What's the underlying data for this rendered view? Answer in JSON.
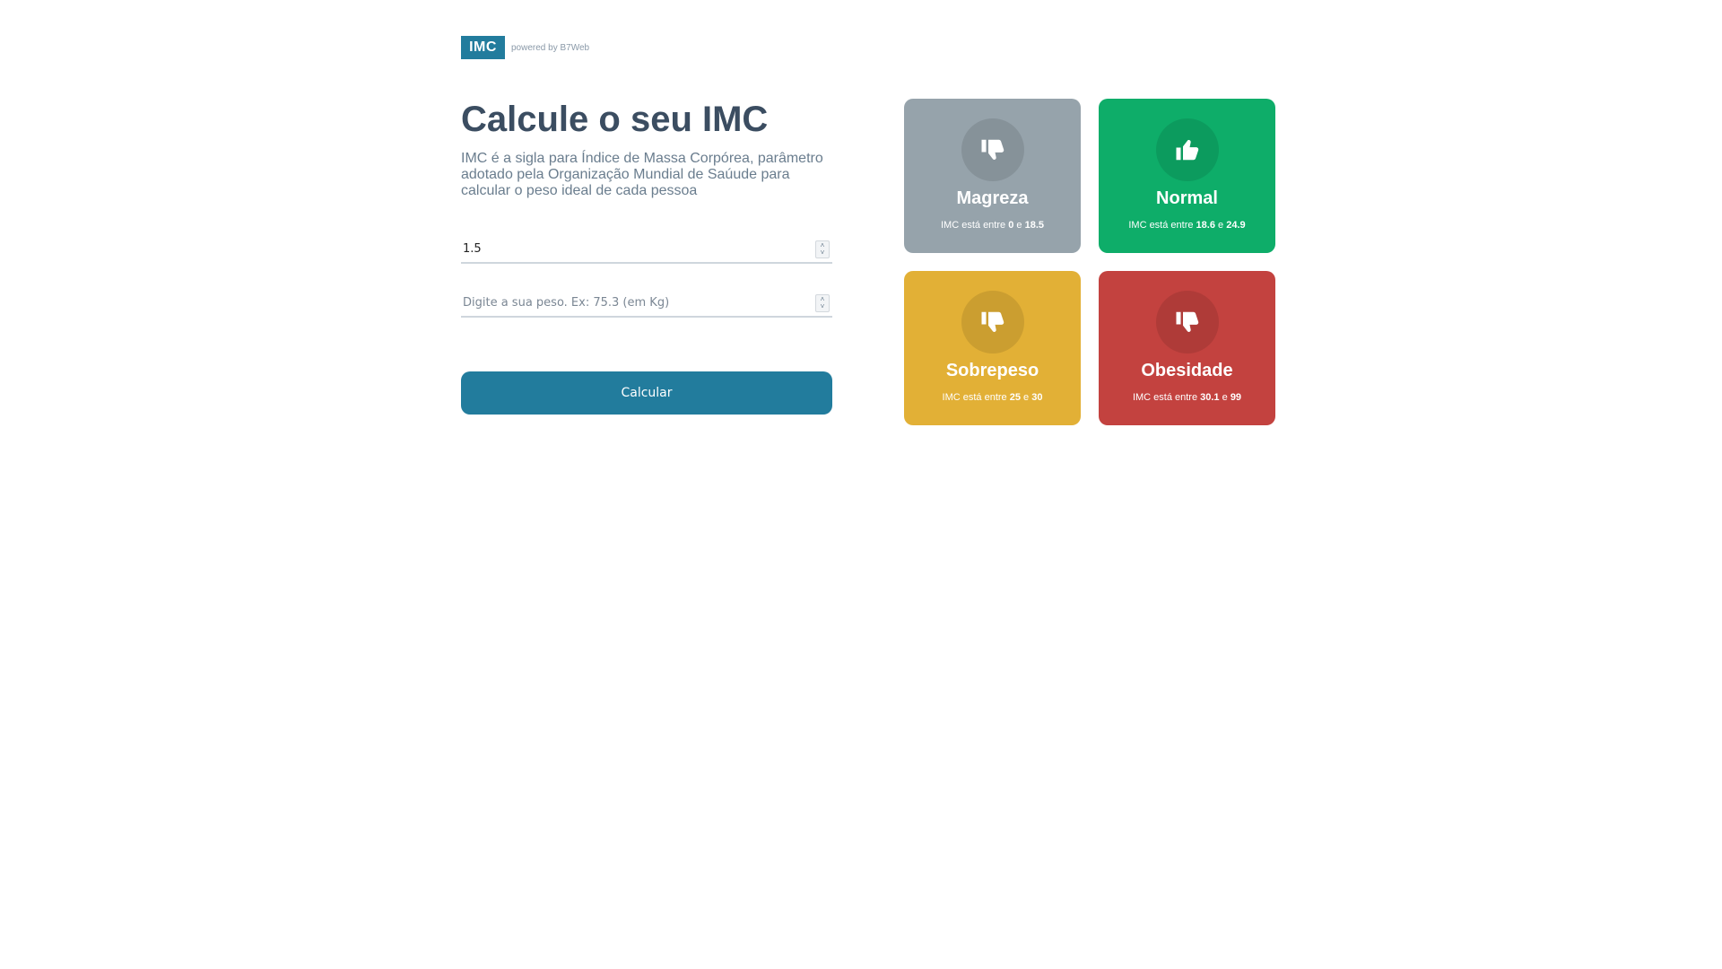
{
  "header": {
    "logo_text": "IMC",
    "powered_text": "powered by B7Web"
  },
  "main": {
    "title": "Calcule o seu IMC",
    "description": "IMC é a sigla para Índice de Massa Corpórea, parâmetro adotado pela Organização Mundial de Saúude para calcular o peso ideal de cada pessoa",
    "altura_input": {
      "value": "1.5",
      "placeholder": ""
    },
    "peso_input": {
      "value": "",
      "placeholder": "Digite a sua peso. Ex: 75.3 (em Kg)"
    },
    "calculate_label": "Calcular"
  },
  "levels": [
    {
      "title": "Magreza",
      "color": "#96a3ab",
      "icon": "thumbs-down-icon",
      "info_prefix": "IMC está entre",
      "min": "0",
      "and": "e",
      "max": "18.5"
    },
    {
      "title": "Normal",
      "color": "#0ead69",
      "icon": "thumbs-up-icon",
      "info_prefix": "IMC está entre",
      "min": "18.6",
      "and": "e",
      "max": "24.9"
    },
    {
      "title": "Sobrepeso",
      "color": "#e2b036",
      "icon": "thumbs-down-icon",
      "info_prefix": "IMC está entre",
      "min": "25",
      "and": "e",
      "max": "30"
    },
    {
      "title": "Obesidade",
      "color": "#c3423f",
      "icon": "thumbs-down-icon",
      "info_prefix": "IMC está entre",
      "min": "30.1",
      "and": "e",
      "max": "99"
    }
  ]
}
